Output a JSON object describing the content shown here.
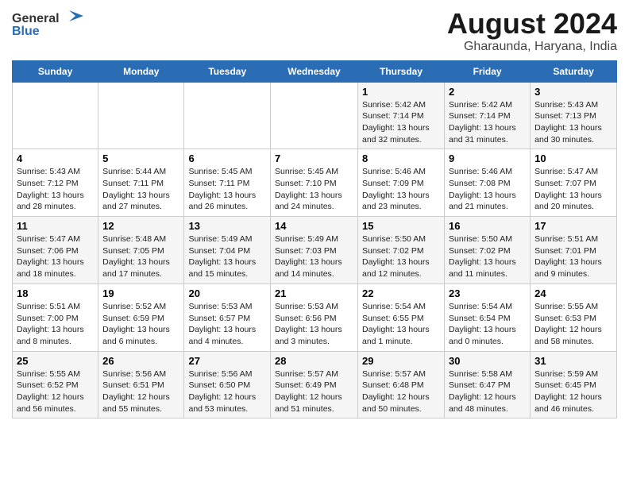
{
  "logo": {
    "general": "General",
    "blue": "Blue"
  },
  "title": "August 2024",
  "subtitle": "Gharaunda, Haryana, India",
  "days_of_week": [
    "Sunday",
    "Monday",
    "Tuesday",
    "Wednesday",
    "Thursday",
    "Friday",
    "Saturday"
  ],
  "weeks": [
    [
      {
        "day": "",
        "info": ""
      },
      {
        "day": "",
        "info": ""
      },
      {
        "day": "",
        "info": ""
      },
      {
        "day": "",
        "info": ""
      },
      {
        "day": "1",
        "info": "Sunrise: 5:42 AM\nSunset: 7:14 PM\nDaylight: 13 hours\nand 32 minutes."
      },
      {
        "day": "2",
        "info": "Sunrise: 5:42 AM\nSunset: 7:14 PM\nDaylight: 13 hours\nand 31 minutes."
      },
      {
        "day": "3",
        "info": "Sunrise: 5:43 AM\nSunset: 7:13 PM\nDaylight: 13 hours\nand 30 minutes."
      }
    ],
    [
      {
        "day": "4",
        "info": "Sunrise: 5:43 AM\nSunset: 7:12 PM\nDaylight: 13 hours\nand 28 minutes."
      },
      {
        "day": "5",
        "info": "Sunrise: 5:44 AM\nSunset: 7:11 PM\nDaylight: 13 hours\nand 27 minutes."
      },
      {
        "day": "6",
        "info": "Sunrise: 5:45 AM\nSunset: 7:11 PM\nDaylight: 13 hours\nand 26 minutes."
      },
      {
        "day": "7",
        "info": "Sunrise: 5:45 AM\nSunset: 7:10 PM\nDaylight: 13 hours\nand 24 minutes."
      },
      {
        "day": "8",
        "info": "Sunrise: 5:46 AM\nSunset: 7:09 PM\nDaylight: 13 hours\nand 23 minutes."
      },
      {
        "day": "9",
        "info": "Sunrise: 5:46 AM\nSunset: 7:08 PM\nDaylight: 13 hours\nand 21 minutes."
      },
      {
        "day": "10",
        "info": "Sunrise: 5:47 AM\nSunset: 7:07 PM\nDaylight: 13 hours\nand 20 minutes."
      }
    ],
    [
      {
        "day": "11",
        "info": "Sunrise: 5:47 AM\nSunset: 7:06 PM\nDaylight: 13 hours\nand 18 minutes."
      },
      {
        "day": "12",
        "info": "Sunrise: 5:48 AM\nSunset: 7:05 PM\nDaylight: 13 hours\nand 17 minutes."
      },
      {
        "day": "13",
        "info": "Sunrise: 5:49 AM\nSunset: 7:04 PM\nDaylight: 13 hours\nand 15 minutes."
      },
      {
        "day": "14",
        "info": "Sunrise: 5:49 AM\nSunset: 7:03 PM\nDaylight: 13 hours\nand 14 minutes."
      },
      {
        "day": "15",
        "info": "Sunrise: 5:50 AM\nSunset: 7:02 PM\nDaylight: 13 hours\nand 12 minutes."
      },
      {
        "day": "16",
        "info": "Sunrise: 5:50 AM\nSunset: 7:02 PM\nDaylight: 13 hours\nand 11 minutes."
      },
      {
        "day": "17",
        "info": "Sunrise: 5:51 AM\nSunset: 7:01 PM\nDaylight: 13 hours\nand 9 minutes."
      }
    ],
    [
      {
        "day": "18",
        "info": "Sunrise: 5:51 AM\nSunset: 7:00 PM\nDaylight: 13 hours\nand 8 minutes."
      },
      {
        "day": "19",
        "info": "Sunrise: 5:52 AM\nSunset: 6:59 PM\nDaylight: 13 hours\nand 6 minutes."
      },
      {
        "day": "20",
        "info": "Sunrise: 5:53 AM\nSunset: 6:57 PM\nDaylight: 13 hours\nand 4 minutes."
      },
      {
        "day": "21",
        "info": "Sunrise: 5:53 AM\nSunset: 6:56 PM\nDaylight: 13 hours\nand 3 minutes."
      },
      {
        "day": "22",
        "info": "Sunrise: 5:54 AM\nSunset: 6:55 PM\nDaylight: 13 hours\nand 1 minute."
      },
      {
        "day": "23",
        "info": "Sunrise: 5:54 AM\nSunset: 6:54 PM\nDaylight: 13 hours\nand 0 minutes."
      },
      {
        "day": "24",
        "info": "Sunrise: 5:55 AM\nSunset: 6:53 PM\nDaylight: 12 hours\nand 58 minutes."
      }
    ],
    [
      {
        "day": "25",
        "info": "Sunrise: 5:55 AM\nSunset: 6:52 PM\nDaylight: 12 hours\nand 56 minutes."
      },
      {
        "day": "26",
        "info": "Sunrise: 5:56 AM\nSunset: 6:51 PM\nDaylight: 12 hours\nand 55 minutes."
      },
      {
        "day": "27",
        "info": "Sunrise: 5:56 AM\nSunset: 6:50 PM\nDaylight: 12 hours\nand 53 minutes."
      },
      {
        "day": "28",
        "info": "Sunrise: 5:57 AM\nSunset: 6:49 PM\nDaylight: 12 hours\nand 51 minutes."
      },
      {
        "day": "29",
        "info": "Sunrise: 5:57 AM\nSunset: 6:48 PM\nDaylight: 12 hours\nand 50 minutes."
      },
      {
        "day": "30",
        "info": "Sunrise: 5:58 AM\nSunset: 6:47 PM\nDaylight: 12 hours\nand 48 minutes."
      },
      {
        "day": "31",
        "info": "Sunrise: 5:59 AM\nSunset: 6:45 PM\nDaylight: 12 hours\nand 46 minutes."
      }
    ]
  ]
}
